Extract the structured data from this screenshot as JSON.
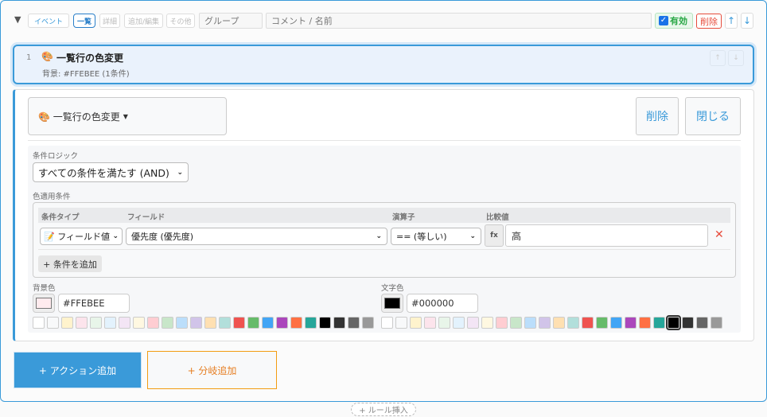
{
  "header": {
    "collapse_icon": "triangle-down",
    "tabs": [
      {
        "label": "イベント"
      },
      {
        "label": "一覧",
        "active": true
      },
      {
        "label": "詳細"
      },
      {
        "label": "追加/編集"
      },
      {
        "label": "その他"
      }
    ],
    "group_placeholder": "グループ",
    "comment_placeholder": "コメント / 名前",
    "enabled_label": "有効",
    "enabled": true,
    "delete_label": "削除",
    "up": "↑",
    "down": "↓"
  },
  "rule": {
    "number": "1",
    "icon": "🎨",
    "title": "一覧行の色変更",
    "summary": "背景: #FFEBEE (1条件)",
    "up": "↑",
    "down": "↓"
  },
  "editor": {
    "action_label": "🎨 一覧行の色変更",
    "delete_label": "削除",
    "close_label": "閉じる",
    "logic_label": "条件ロジック",
    "logic_value": "すべての条件を満たす (AND)",
    "conditions_label": "色適用条件",
    "columns": [
      "条件タイプ",
      "フィールド",
      "演算子",
      "比較値"
    ],
    "condition": {
      "type": "📝 フィールド値",
      "field": "優先度 (優先度)",
      "operator": "== (等しい)",
      "fx": "fx",
      "value": "高",
      "remove": "✕"
    },
    "add_condition": "+ 条件を追加",
    "bg_label": "背景色",
    "bg_value": "#FFEBEE",
    "text_label": "文字色",
    "text_value": "#000000",
    "palette": [
      "#ffffff",
      "#f8f9fa",
      "#fff3cd",
      "#fce4ec",
      "#e8f5e9",
      "#e3f2fd",
      "#f3e5f5",
      "#fff8e1",
      "#ffcdd2",
      "#c8e6c9",
      "#bbdefb",
      "#d1c4e9",
      "#ffe0b2",
      "#b2dfdb",
      "#ef5350",
      "#66bb6a",
      "#42a5f5",
      "#ab47bc",
      "#ff7043",
      "#26a69a",
      "#000000",
      "#333333",
      "#666666",
      "#999999"
    ]
  },
  "footer": {
    "add_action": "+ アクション追加",
    "add_branch": "+ 分岐追加",
    "insert_rule": "+ ルール挿入"
  },
  "colors": {
    "accent": "#3a9ad9",
    "orange": "#f39c12",
    "danger": "#e74c3c",
    "success": "#28a745"
  }
}
